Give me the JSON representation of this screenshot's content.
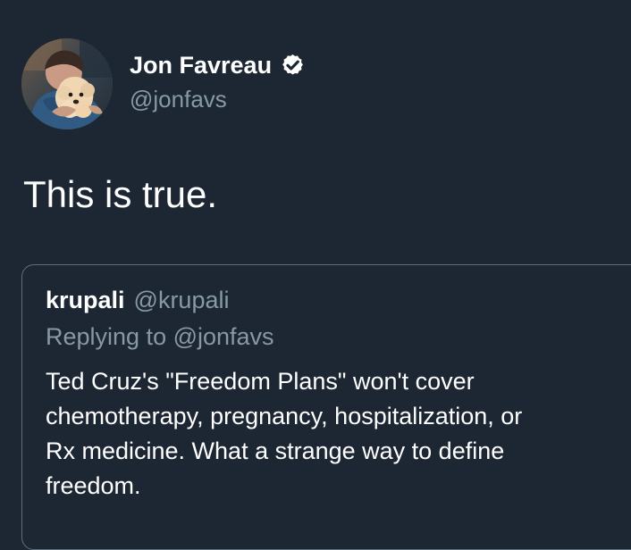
{
  "tweet": {
    "author": {
      "name": "Jon Favreau",
      "handle": "@jonfavs",
      "verified": true,
      "avatar_icon": "profile-photo-with-dog"
    },
    "text": "This is true.",
    "quoted_tweet": {
      "author": {
        "name": "krupali",
        "handle": "@krupali"
      },
      "reply_context": "Replying to @jonfavs",
      "text": "Ted Cruz's \"Freedom Plans\" won't cover\nchemotherapy, pregnancy, hospitalization, or\nRx medicine.  What a strange way to define\nfreedom."
    }
  },
  "colors": {
    "background": "#1c2733",
    "primary_text": "#ffffff",
    "secondary_text": "#8899a6",
    "border": "#5b6f81"
  }
}
